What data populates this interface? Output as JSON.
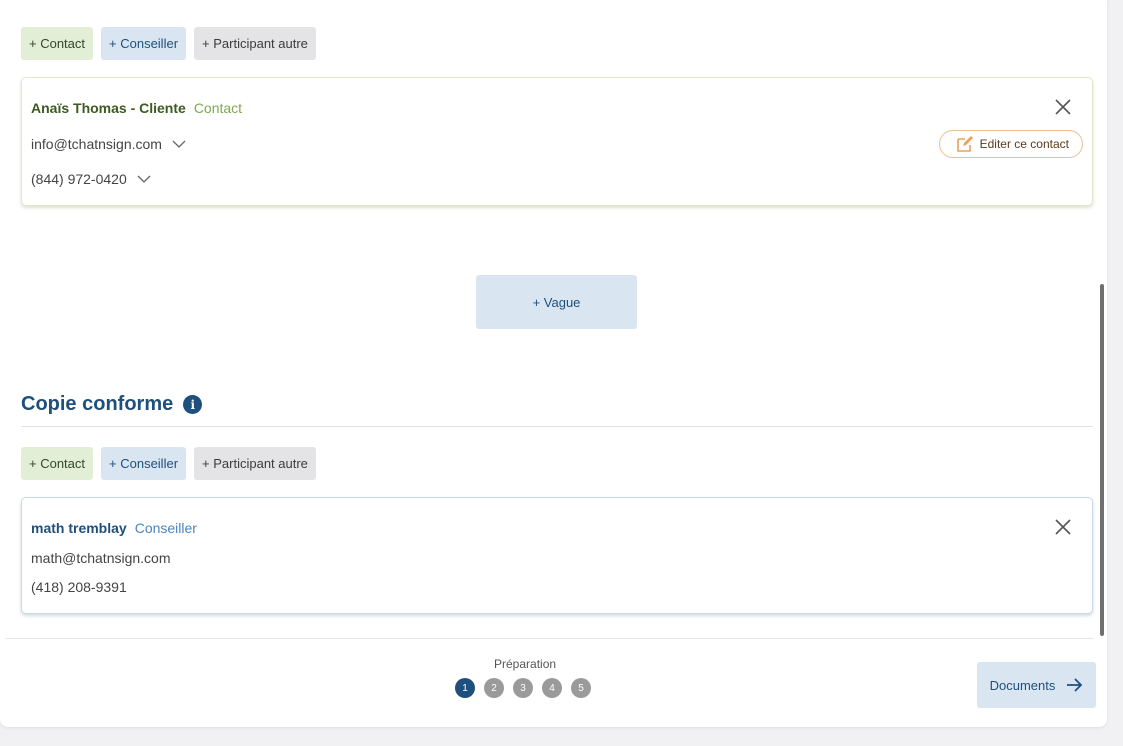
{
  "participants": {
    "buttons": {
      "contact": "+ Contact",
      "conseiller": "+ Conseiller",
      "autre": "+ Participant autre"
    },
    "card": {
      "name": "Anaïs Thomas - Cliente",
      "role": "Contact",
      "email": "info@tchatnsign.com",
      "phone": "(844) 972-0420",
      "edit_label": "Editer ce contact"
    }
  },
  "vague_button": "+ Vague",
  "copie": {
    "title": "Copie conforme",
    "info_icon": "i",
    "buttons": {
      "contact": "+ Contact",
      "conseiller": "+ Conseiller",
      "autre": "+ Participant autre"
    },
    "card": {
      "name": "math tremblay",
      "role": "Conseiller",
      "email": "math@tchatnsign.com",
      "phone": "(418) 208-9391"
    }
  },
  "footer": {
    "step_label": "Préparation",
    "steps": [
      "1",
      "2",
      "3",
      "4",
      "5"
    ],
    "next_label": "Documents"
  },
  "colors": {
    "accent_blue": "#1f4f7c",
    "contact_green": "#7aab4c",
    "edit_orange": "#e8a25b"
  },
  "icons": {
    "close": "close-icon",
    "chevron": "chevron-down-icon",
    "edit": "edit-icon",
    "info": "info-icon",
    "arrow": "arrow-right-icon"
  }
}
